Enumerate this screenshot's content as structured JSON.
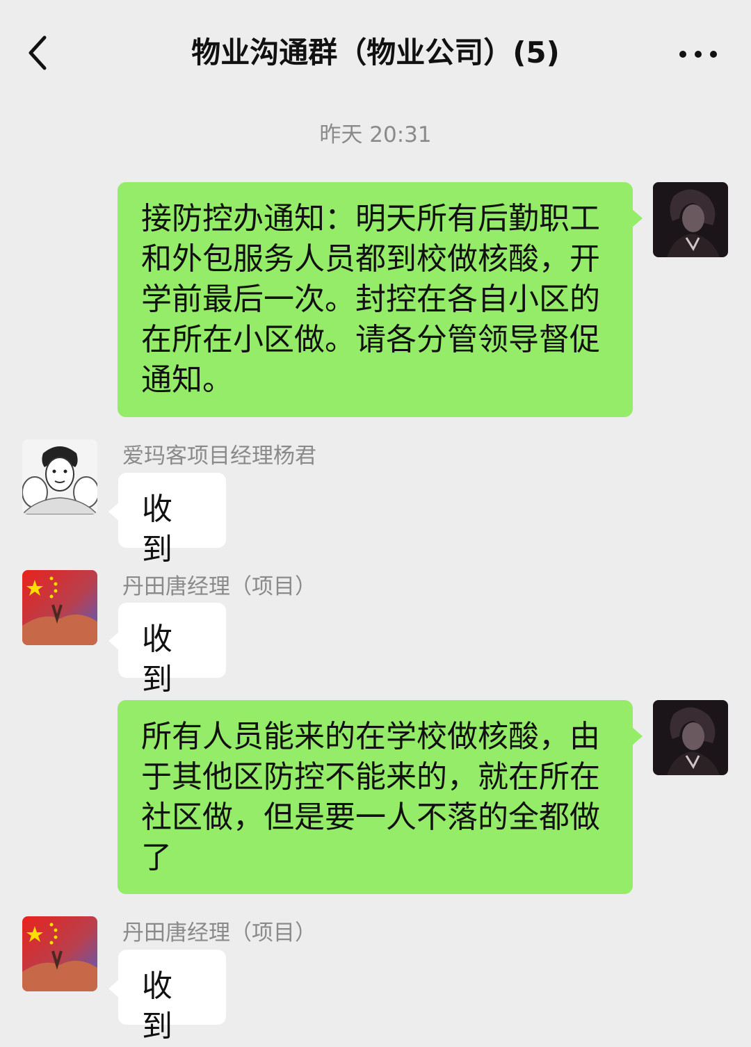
{
  "header": {
    "title": "物业沟通群（物业公司）(5)",
    "back_icon": "chevron-left-icon",
    "more_icon": "more-dots-icon"
  },
  "timestamp": "昨天 20:31",
  "messages": [
    {
      "direction": "outgoing",
      "text": "接防控办通知：明天所有后勤职工和外包服务人员都到校做核酸，开学前最后一次。封控在各自小区的在所在小区做。请各分管领导督促通知。"
    },
    {
      "direction": "incoming",
      "sender": "爱玛客项目经理杨君",
      "text": "收到"
    },
    {
      "direction": "incoming",
      "sender": "丹田唐经理（项目）",
      "text": "收到"
    },
    {
      "direction": "outgoing",
      "text": "所有人员能来的在学校做核酸，由于其他区防控不能来的，就在所在社区做，但是要一人不落的全都做了"
    },
    {
      "direction": "incoming",
      "sender": "丹田唐经理（项目）",
      "text": "收到"
    }
  ],
  "colors": {
    "background": "#ededed",
    "outgoing_bubble": "#95ec69",
    "incoming_bubble": "#ffffff",
    "meta_text": "#8a8a8a"
  }
}
